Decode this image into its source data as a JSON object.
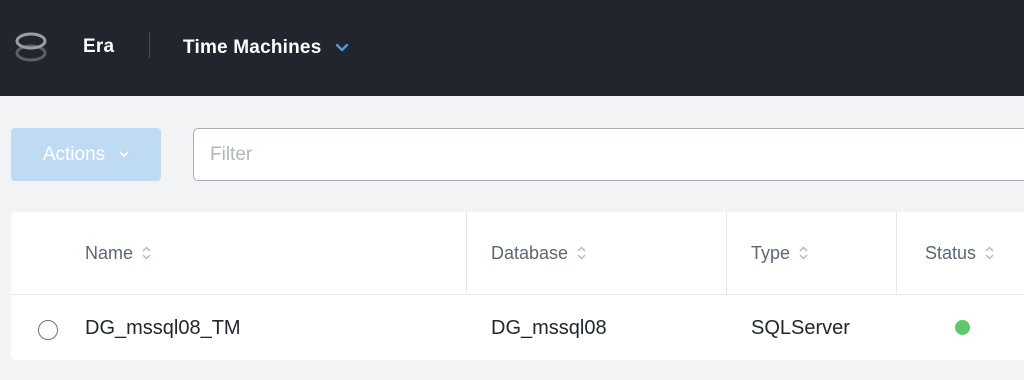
{
  "header": {
    "app_name": "Era",
    "section_title": "Time Machines"
  },
  "toolbar": {
    "actions_label": "Actions",
    "filter_placeholder": "Filter"
  },
  "table": {
    "columns": [
      "Name",
      "Database",
      "Type",
      "Status"
    ],
    "rows": [
      {
        "name": "DG_mssql08_TM",
        "database": "DG_mssql08",
        "type": "SQLServer",
        "status": "online",
        "selected": false
      }
    ]
  },
  "colors": {
    "topbar_bg": "#22252e",
    "accent": "#4a9be8",
    "actions_disabled_bg": "#bfdaf3",
    "status_ok": "#5ec66b"
  },
  "icons": {
    "logo": "era-logo-icon",
    "dropdown": "chevron-down-icon",
    "sort": "sort-icon",
    "status": "status-dot-icon"
  }
}
